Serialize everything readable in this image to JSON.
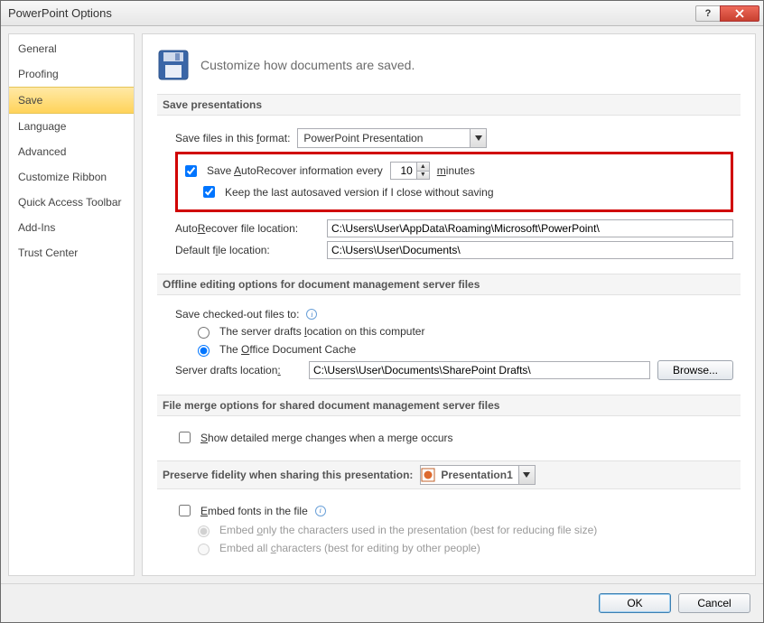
{
  "window": {
    "title": "PowerPoint Options"
  },
  "sidebar": {
    "items": [
      {
        "label": "General"
      },
      {
        "label": "Proofing"
      },
      {
        "label": "Save"
      },
      {
        "label": "Language"
      },
      {
        "label": "Advanced"
      },
      {
        "label": "Customize Ribbon"
      },
      {
        "label": "Quick Access Toolbar"
      },
      {
        "label": "Add-Ins"
      },
      {
        "label": "Trust Center"
      }
    ],
    "selected_index": 2
  },
  "heading": "Customize how documents are saved.",
  "save_presentations": {
    "header": "Save presentations",
    "format_label": "Save files in this format:",
    "format_value": "PowerPoint Presentation",
    "autorecover_label": "Save AutoRecover information every",
    "autorecover_value": "10",
    "autorecover_unit": "minutes",
    "keep_last_label": "Keep the last autosaved version if I close without saving",
    "autorecover_loc_label": "AutoRecover file location:",
    "autorecover_loc_value": "C:\\Users\\User\\AppData\\Roaming\\Microsoft\\PowerPoint\\",
    "default_loc_label": "Default file location:",
    "default_loc_value": "C:\\Users\\User\\Documents\\"
  },
  "offline": {
    "header": "Offline editing options for document management server files",
    "save_to_label": "Save checked-out files to:",
    "opt_server_drafts": "The server drafts location on this computer",
    "opt_office_cache": "The Office Document Cache",
    "server_drafts_label": "Server drafts location:",
    "server_drafts_value": "C:\\Users\\User\\Documents\\SharePoint Drafts\\",
    "browse_label": "Browse..."
  },
  "merge": {
    "header": "File merge options for shared document management server files",
    "show_detailed": "Show detailed merge changes when a merge occurs"
  },
  "preserve": {
    "header": "Preserve fidelity when sharing this presentation:",
    "combo_value": "Presentation1",
    "embed_fonts": "Embed fonts in the file",
    "embed_only": "Embed only the characters used in the presentation (best for reducing file size)",
    "embed_all": "Embed all characters (best for editing by other people)"
  },
  "footer": {
    "ok": "OK",
    "cancel": "Cancel"
  }
}
